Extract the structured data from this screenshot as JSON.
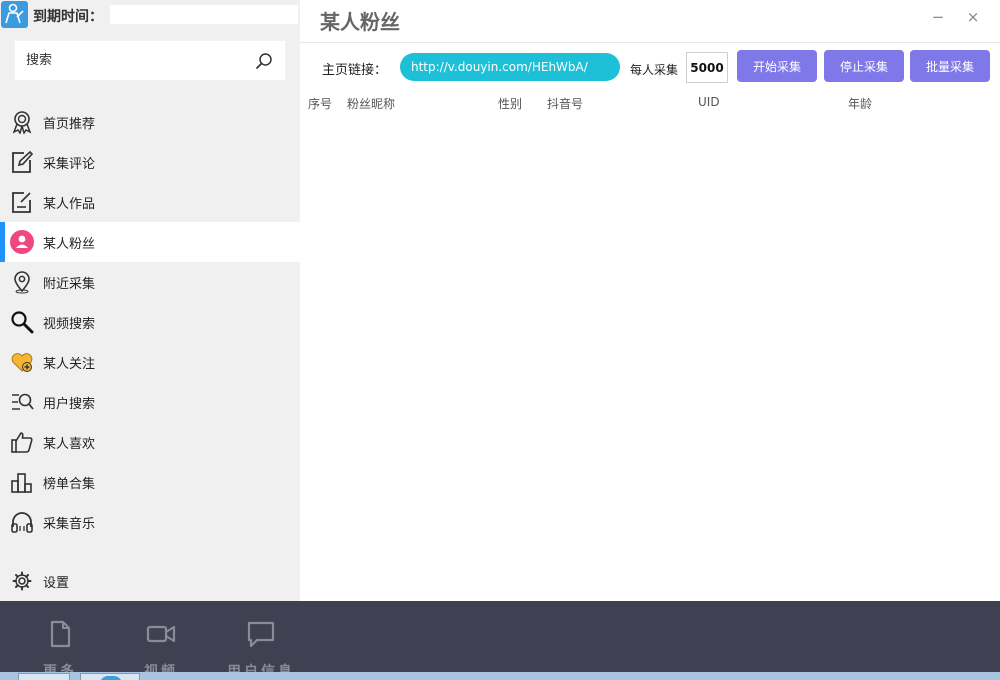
{
  "brand": {
    "label": "到期时间："
  },
  "search": {
    "placeholder": "搜索"
  },
  "nav": {
    "items": [
      {
        "label": "首页推荐",
        "icon": "award-icon"
      },
      {
        "label": "采集评论",
        "icon": "edit-icon"
      },
      {
        "label": "某人作品",
        "icon": "note-icon"
      },
      {
        "label": "某人粉丝",
        "icon": "user-icon",
        "active": true
      },
      {
        "label": "附近采集",
        "icon": "location-pin-icon"
      },
      {
        "label": "视频搜索",
        "icon": "search-icon"
      },
      {
        "label": "某人关注",
        "icon": "heart-add-icon"
      },
      {
        "label": "用户搜索",
        "icon": "list-search-icon"
      },
      {
        "label": "某人喜欢",
        "icon": "thumbs-up-icon"
      },
      {
        "label": "榜单合集",
        "icon": "bar-chart-icon"
      },
      {
        "label": "采集音乐",
        "icon": "headphones-icon"
      }
    ],
    "settings_label": "设置"
  },
  "header": {
    "title": "某人粉丝",
    "minimize": "−",
    "close": "×"
  },
  "toolbar": {
    "url_label": "主页链接：",
    "url_value": "http://v.douyin.com/HEhWbA/",
    "per_label": "每人采集",
    "per_value": "5000",
    "start_label": "开始采集",
    "stop_label": "停止采集",
    "batch_label": "批量采集"
  },
  "table": {
    "columns": [
      "序号",
      "粉丝昵称",
      "性别",
      "抖音号",
      "UID",
      "年龄"
    ]
  },
  "bottom_nav": {
    "items": [
      {
        "label": "更多",
        "icon": "document-icon"
      },
      {
        "label": "视频",
        "icon": "video-camera-icon"
      },
      {
        "label": "用户信息",
        "icon": "chat-icon"
      }
    ]
  },
  "colors": {
    "accent": "#7e78e8",
    "url_pill": "#1ec0d8",
    "active_indicator": "#1e90ff",
    "bottom_bar": "#3f4051"
  }
}
